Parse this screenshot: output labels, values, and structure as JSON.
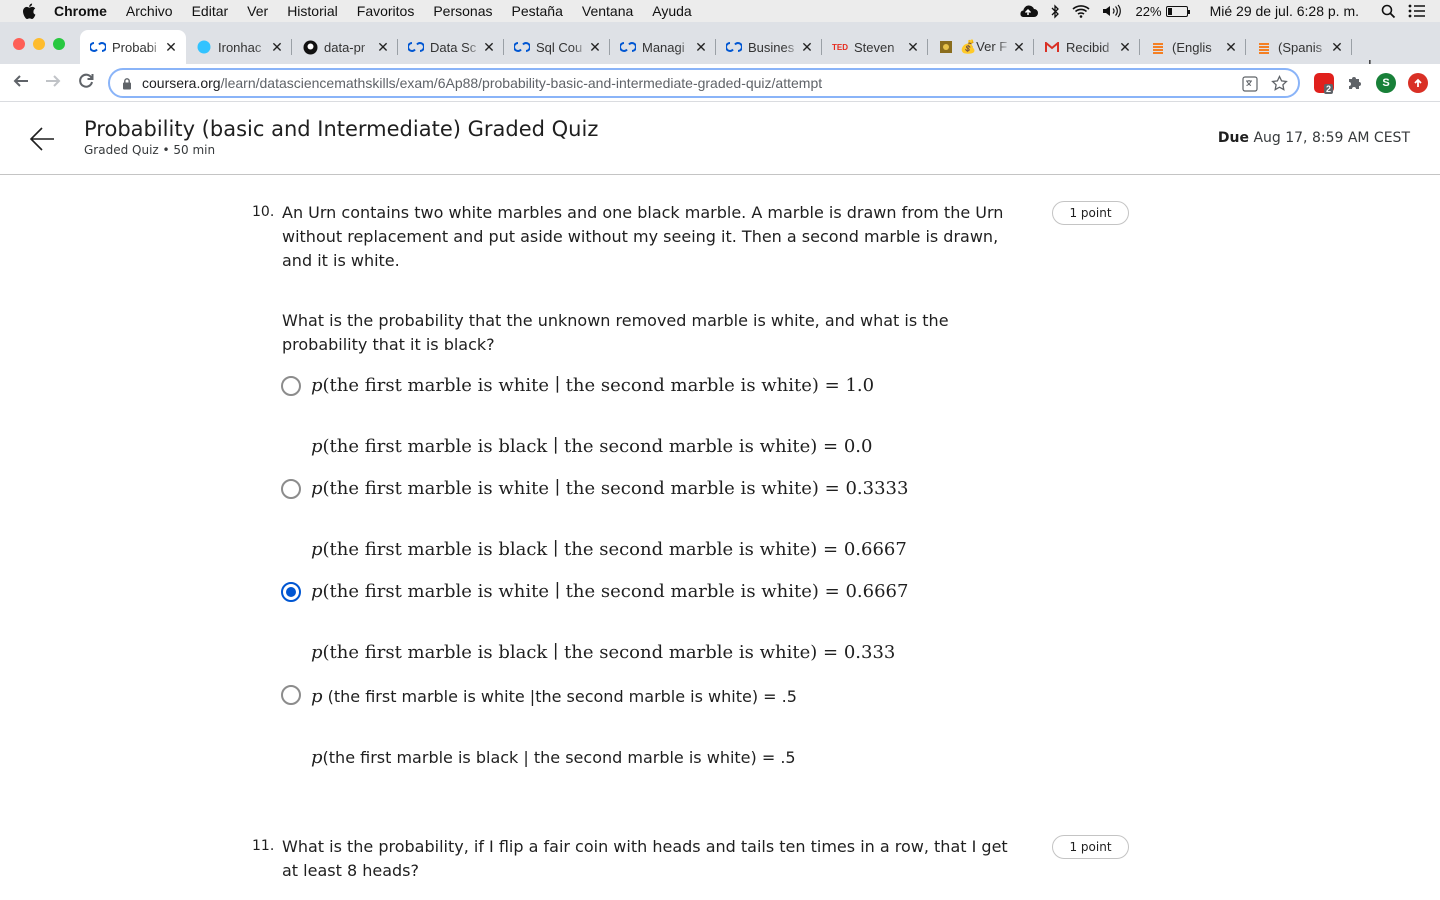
{
  "menubar": {
    "app": "Chrome",
    "items": [
      "Archivo",
      "Editar",
      "Ver",
      "Historial",
      "Favoritos",
      "Personas",
      "Pestaña",
      "Ventana",
      "Ayuda"
    ],
    "battery": "22%",
    "battery_level": 0.22,
    "clock": "Mié 29 de jul.  6:28 p. m."
  },
  "tabs": [
    {
      "title": "Probabi",
      "icon": "coursera-icon",
      "active": true
    },
    {
      "title": "Ironhac",
      "icon": "ironhack-icon"
    },
    {
      "title": "data-pr",
      "icon": "github-icon"
    },
    {
      "title": "Data Sc",
      "icon": "coursera-icon"
    },
    {
      "title": "Sql Cou",
      "icon": "coursera-icon"
    },
    {
      "title": "Managi",
      "icon": "coursera-icon"
    },
    {
      "title": "Busines",
      "icon": "coursera-icon"
    },
    {
      "title": "Steven",
      "icon": "ted-icon"
    },
    {
      "title": "💰Ver F",
      "icon": "gold-icon"
    },
    {
      "title": "Recibid",
      "icon": "gmail-icon"
    },
    {
      "title": "(Englis",
      "icon": "stack-icon"
    },
    {
      "title": "(Spanis",
      "icon": "stack-icon"
    }
  ],
  "address_bar": {
    "host": "coursera.org",
    "path": "/learn/datasciencemathskills/exam/6Ap88/probability-basic-and-intermediate-graded-quiz/attempt",
    "ext_badge": "2",
    "profile": "S"
  },
  "quiz": {
    "title": "Probability (basic and Intermediate) Graded Quiz",
    "subtitle": "Graded Quiz • 50 min",
    "due_label": "Due",
    "due_value": "Aug 17, 8:59 AM CEST"
  },
  "q10": {
    "number": "10.",
    "points": "1 point",
    "text1": "An Urn contains two white marbles and one black marble. A marble is drawn from the Urn without replacement and put aside without my seeing it. Then a second marble is drawn, and it is white.",
    "text2": "What is the probability that the unknown removed marble is white, and what is the probability that it is black?",
    "options": [
      {
        "line1": "(the first marble is white ∣ the second marble is white) = 1.0",
        "line2": "(the first marble is black ∣ the second marble is white) = 0.0",
        "selected": false
      },
      {
        "line1": "(the first marble is white ∣ the second marble is white) = 0.3333",
        "line2": "(the first marble is black ∣ the second marble is white) = 0.6667",
        "selected": false
      },
      {
        "line1": "(the first marble is white ∣ the second marble is white) = 0.6667",
        "line2": "(the first marble is black ∣ the second marble is white) = 0.333",
        "selected": true
      },
      {
        "line1": " (the first marble is white  |the second marble is white) = .5",
        "line2": "(the first marble is black | the second marble is white) = .5",
        "selected": false
      }
    ]
  },
  "q11": {
    "number": "11.",
    "points": "1 point",
    "text": "What is the probability, if I flip a fair coin with heads and tails ten times in a row, that I get at least 8 heads?"
  }
}
